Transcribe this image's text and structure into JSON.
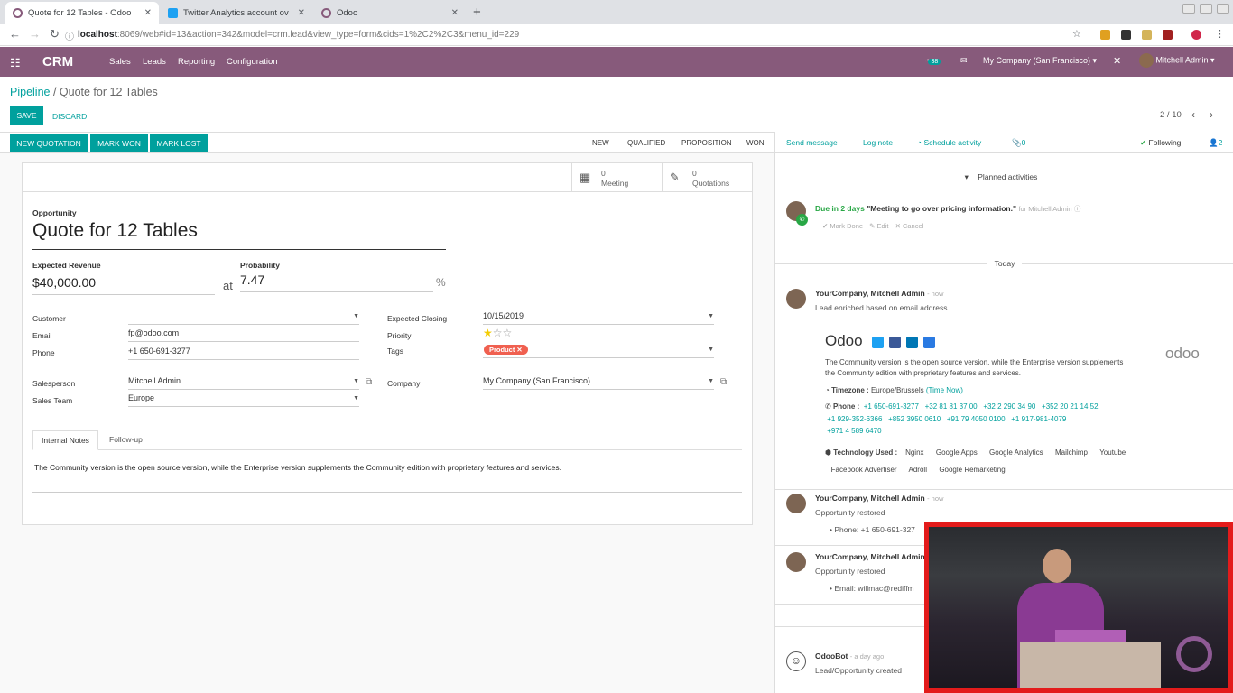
{
  "browser": {
    "tabs": [
      {
        "title": "Quote for 12 Tables - Odoo"
      },
      {
        "title": "Twitter Analytics account ov"
      },
      {
        "title": "Odoo"
      }
    ],
    "url_host": "localhost",
    "url_rest": ":8069/web#id=13&action=342&model=crm.lead&view_type=form&cids=1%2C2%2C3&menu_id=229"
  },
  "navbar": {
    "app": "CRM",
    "menus": [
      "Sales",
      "Leads",
      "Reporting",
      "Configuration"
    ],
    "badge": "38",
    "company": "My Company (San Francisco)",
    "user": "Mitchell Admin"
  },
  "breadcrumb": {
    "parent": "Pipeline",
    "current": "Quote for 12 Tables"
  },
  "control": {
    "save": "SAVE",
    "discard": "DISCARD",
    "pager": "2 / 10"
  },
  "header_buttons": {
    "new_quotation": "NEW QUOTATION",
    "mark_won": "MARK WON",
    "mark_lost": "MARK LOST"
  },
  "stages": [
    "NEW",
    "QUALIFIED",
    "PROPOSITION",
    "WON"
  ],
  "smart_buttons": {
    "meeting_count": "0",
    "meeting_label": "Meeting",
    "quotation_count": "0",
    "quotation_label": "Quotations"
  },
  "form": {
    "opportunity_label": "Opportunity",
    "name": "Quote for 12 Tables",
    "expected_revenue_label": "Expected Revenue",
    "expected_revenue": "$40,000.00",
    "at": "at",
    "probability_label": "Probability",
    "probability": "7.47",
    "percent": "%",
    "customer_label": "Customer",
    "customer": "",
    "email_label": "Email",
    "email": "fp@odoo.com",
    "phone_label": "Phone",
    "phone": "+1 650-691-3277",
    "salesperson_label": "Salesperson",
    "salesperson": "Mitchell Admin",
    "sales_team_label": "Sales Team",
    "sales_team": "Europe",
    "expected_closing_label": "Expected Closing",
    "expected_closing": "10/15/2019",
    "priority_label": "Priority",
    "priority": 1,
    "tags_label": "Tags",
    "tag": "Product",
    "company_label": "Company",
    "company": "My Company (San Francisco)"
  },
  "notebook": {
    "tabs": [
      "Internal Notes",
      "Follow-up"
    ],
    "notes": "The Community version is the open source version, while the Enterprise version supplements the Community edition with proprietary features and services."
  },
  "chatter": {
    "send_message": "Send message",
    "log_note": "Log note",
    "schedule": "Schedule activity",
    "attachments": "0",
    "following": "Following",
    "followers": "2",
    "planned_title": "Planned activities",
    "activity": {
      "due": "Due in 2 days",
      "summary": "\"Meeting to go over pricing information.\"",
      "for": "for Mitchell Admin",
      "done": "Mark Done",
      "edit": "Edit",
      "cancel": "Cancel"
    },
    "today": "Today",
    "msg1": {
      "author": "YourCompany, Mitchell Admin",
      "time": "- now",
      "text": "Lead enriched based on email address"
    },
    "card": {
      "name": "Odoo",
      "logo": "odoo",
      "desc": "The Community version is the open source version, while the Enterprise version supplements the Community edition with proprietary features and services.",
      "tz_label": "Timezone :",
      "tz": "Europe/Brussels",
      "tz_now": "(Time Now)",
      "phone_label": "Phone :",
      "phones": [
        "+1 650-691-3277",
        "+32 81 81 37 00",
        "+32 2 290 34 90",
        "+352 20 21 14 52",
        "+1 929-352-6366",
        "+852 3950 0610",
        "+91 79 4050 0100",
        "+1 917-981-4079",
        "+971 4 589 6470"
      ],
      "tech_label": "Technology Used :",
      "tech": [
        "Nginx",
        "Google Apps",
        "Google Analytics",
        "Mailchimp",
        "Youtube",
        "Facebook Advertiser",
        "Adroll",
        "Google Remarketing"
      ]
    },
    "msg2": {
      "author": "YourCompany, Mitchell Admin",
      "time": "- now",
      "text": "Opportunity restored",
      "detail": "Phone: +1 650-691-327"
    },
    "msg3": {
      "author": "YourCompany, Mitchell Admin",
      "text": "Opportunity restored",
      "detail": "Email: willmac@rediffm"
    },
    "msg4": {
      "author": "OdooBot",
      "time": "- a day ago",
      "text": "Lead/Opportunity created"
    }
  },
  "colors": {
    "brand": "#875a7b",
    "accent": "#00a09d",
    "tag": "#f06050",
    "video_border": "#e31b1b"
  }
}
